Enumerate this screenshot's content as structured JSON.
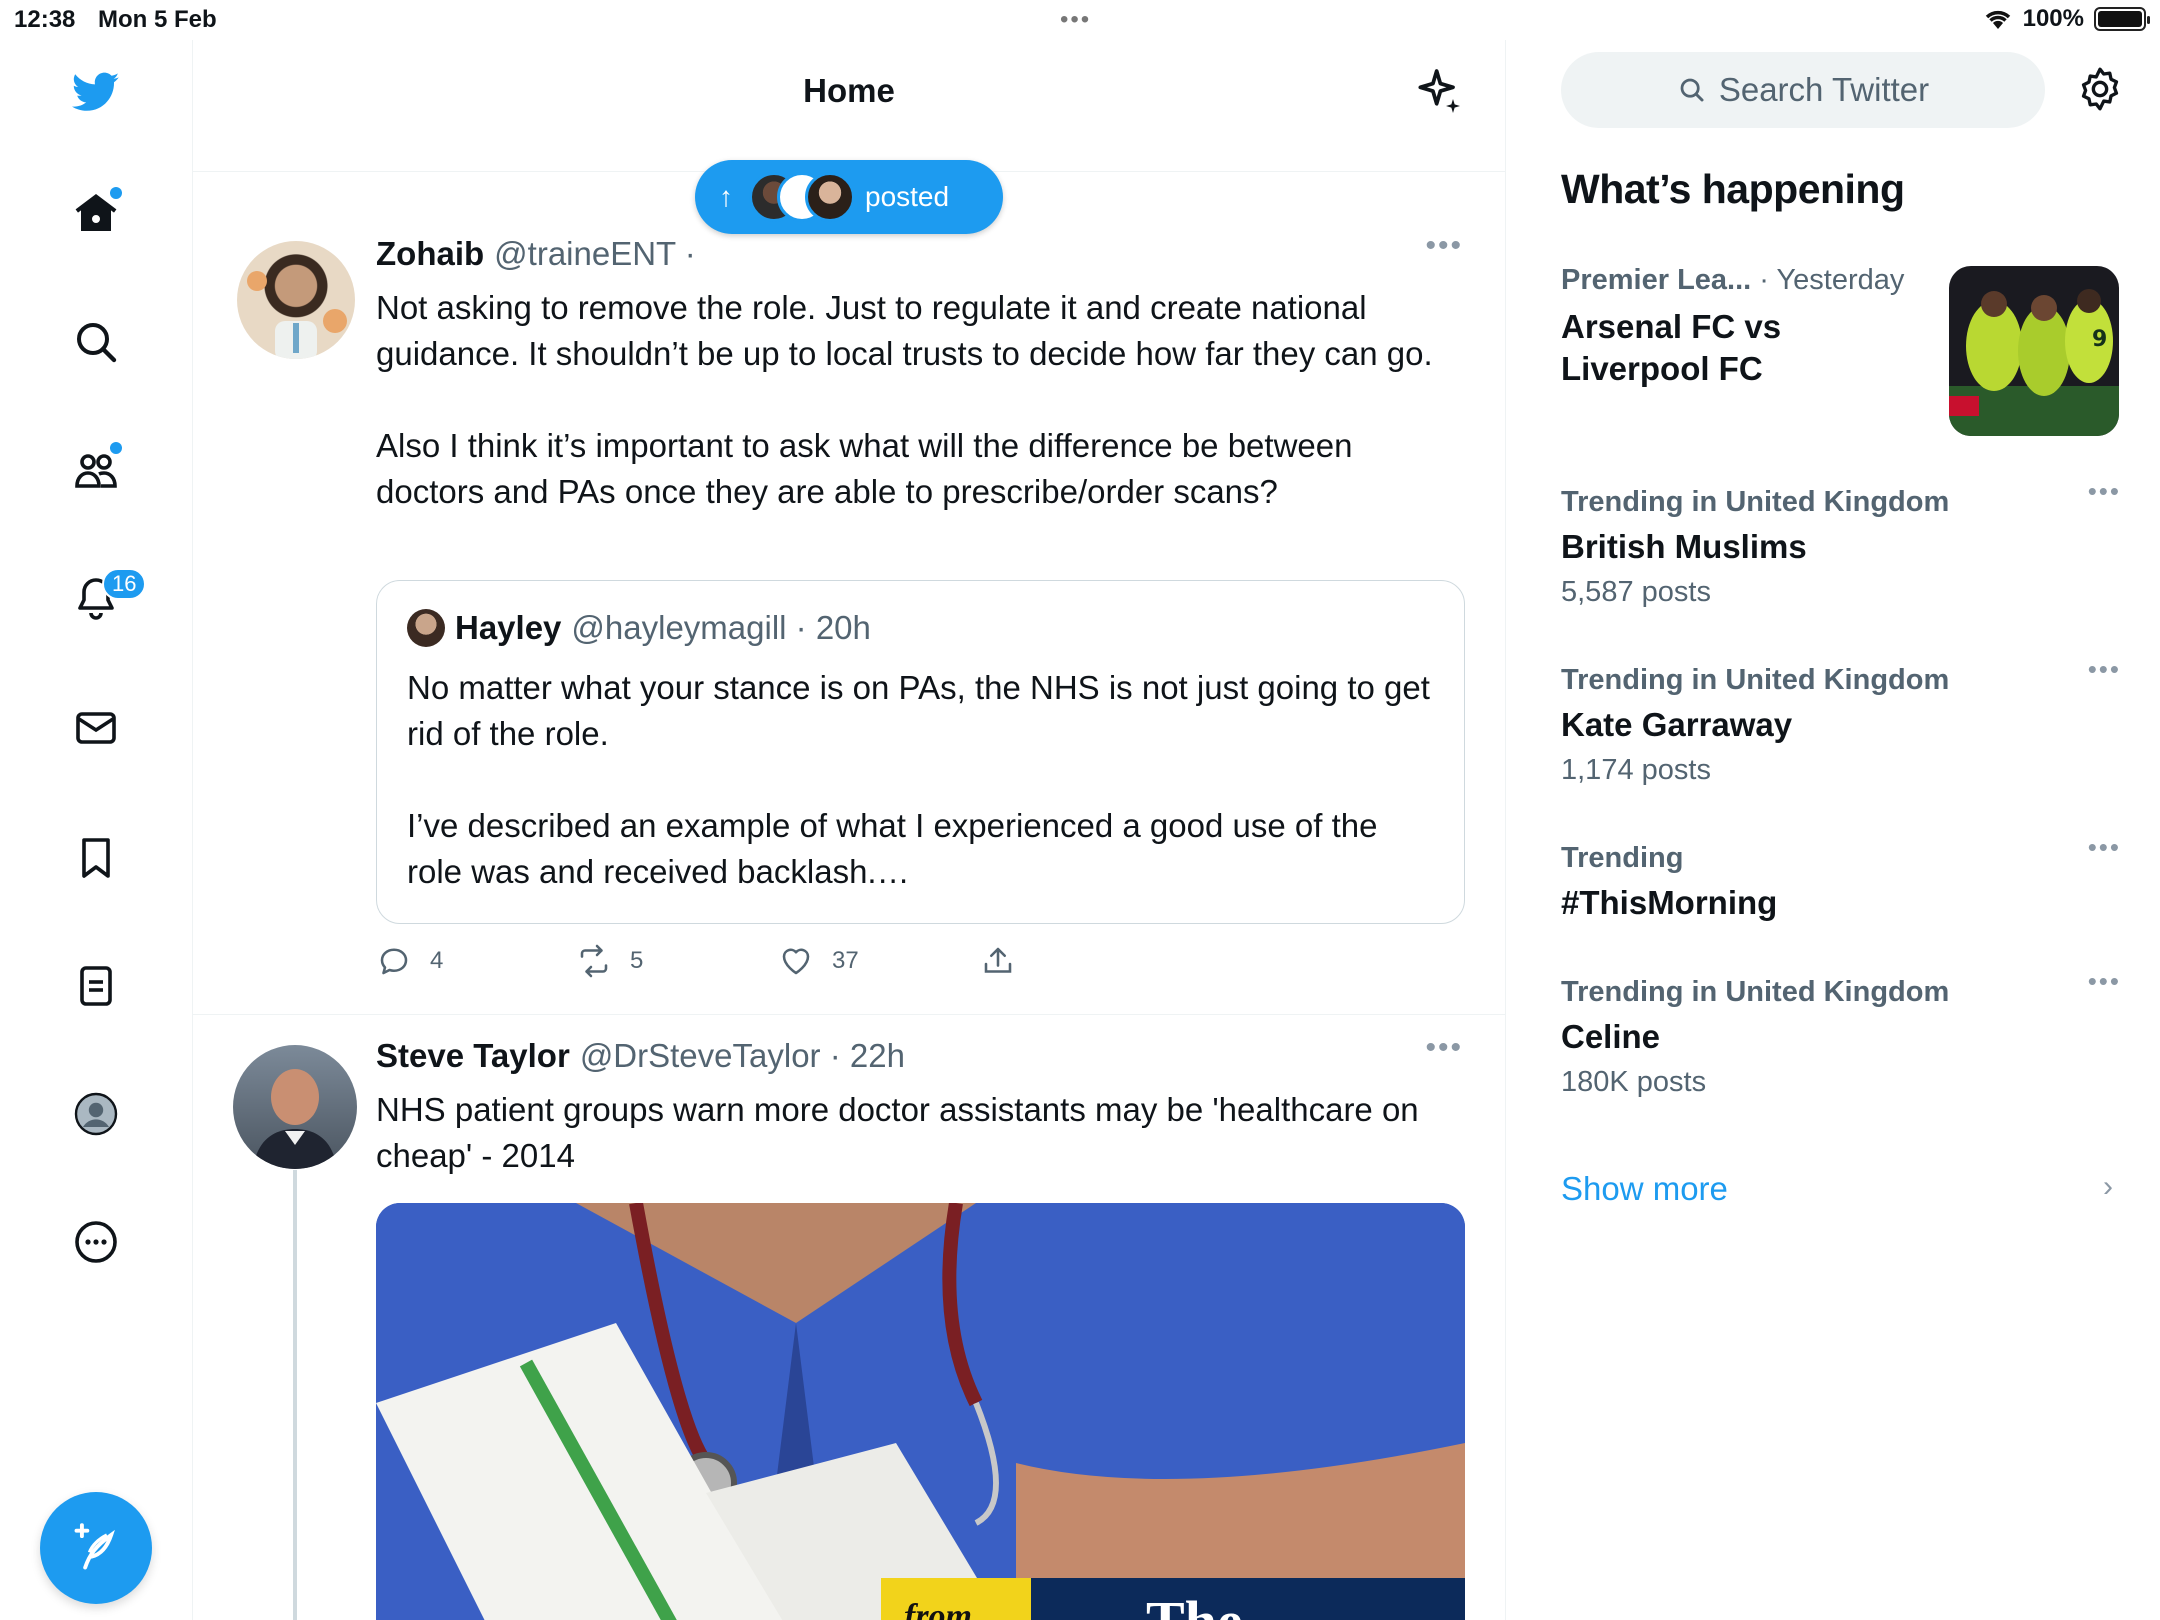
{
  "status_bar": {
    "time": "12:38",
    "date": "Mon 5 Feb",
    "battery": "100%",
    "battery_level": 1.0
  },
  "nav": {
    "items": [
      "home-icon",
      "search-icon",
      "communities-icon",
      "notifications-icon",
      "messages-icon",
      "bookmarks-icon",
      "lists-icon",
      "profile-icon",
      "more-icon"
    ],
    "notifications_badge": "16"
  },
  "header": {
    "title": "Home"
  },
  "new_posts_pill": {
    "label": "posted"
  },
  "tweets": [
    {
      "author": "Zohaib",
      "handle": "@traineENT ·",
      "text_p1": "Not asking to remove the role. Just to regulate it and create national guidance. It shouldn’t be up to local trusts to decide how far they can go.",
      "text_p2": "Also I think it’s important to ask what will the difference be between doctors and PAs once they are able to prescribe/order scans?",
      "quote": {
        "author": "Hayley",
        "handle": "@hayleymagill · 20h",
        "text_p1": "No matter what your stance is on PAs, the NHS is not just going to get rid of the role.",
        "text_p2": "I’ve described an example of what I experienced a good use of the role was and received backlash.…"
      },
      "replies": "4",
      "reposts": "5",
      "likes": "37"
    },
    {
      "author": "Steve Taylor",
      "handle": "@DrSteveTaylor · 22h",
      "text": "NHS patient groups warn more doctor assistants may be 'healthcare on cheap' - 2014",
      "media_caption_1": "from",
      "media_caption_2": "The"
    }
  ],
  "sidebar": {
    "search_placeholder": "Search Twitter",
    "section_title": "What’s happening",
    "trends": [
      {
        "category": "Premier Lea...",
        "time": "· Yesterday",
        "title_line1": "Arsenal FC vs",
        "title_line2": "Liverpool FC"
      },
      {
        "category": "Trending in United Kingdom",
        "title": "British Muslims",
        "count": "5,587 posts"
      },
      {
        "category": "Trending in United Kingdom",
        "title": "Kate Garraway",
        "count": "1,174 posts"
      },
      {
        "category": "Trending",
        "title": "#ThisMorning"
      },
      {
        "category": "Trending in United Kingdom",
        "title": "Celine",
        "count": "180K posts"
      }
    ],
    "show_more": "Show more"
  },
  "colors": {
    "accent": "#1d9bf0",
    "text": "#0f1419",
    "secondary": "#536471",
    "border": "#eff3f4"
  }
}
